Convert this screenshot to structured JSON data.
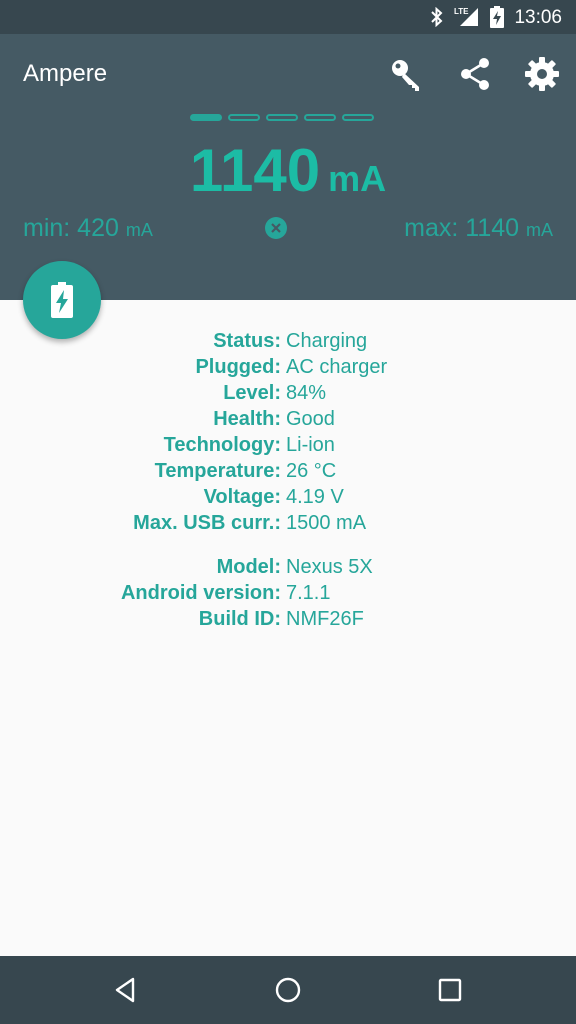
{
  "status_bar": {
    "time": "13:06",
    "network": "LTE",
    "icons": [
      "bluetooth-icon",
      "cellular-signal-icon",
      "battery-charging-icon"
    ]
  },
  "app_bar": {
    "title": "Ampere",
    "actions": [
      "key-icon",
      "share-icon",
      "settings-icon"
    ]
  },
  "page_indicator": {
    "total": 5,
    "active_index": 0
  },
  "reading": {
    "value": "1140",
    "unit": "mA"
  },
  "min": {
    "label": "min: 420",
    "unit": "mA"
  },
  "max": {
    "label": "max: 1140",
    "unit": "mA"
  },
  "battery_info": [
    {
      "label": "Status:",
      "value": "Charging"
    },
    {
      "label": "Plugged:",
      "value": "AC charger"
    },
    {
      "label": "Level:",
      "value": "84%"
    },
    {
      "label": "Health:",
      "value": "Good"
    },
    {
      "label": "Technology:",
      "value": "Li-ion"
    },
    {
      "label": "Temperature:",
      "value": "26 °C"
    },
    {
      "label": "Voltage:",
      "value": "4.19 V"
    },
    {
      "label": "Max. USB curr.:",
      "value": "1500 mA"
    }
  ],
  "device_info": [
    {
      "label": "Model:",
      "value": "Nexus 5X"
    },
    {
      "label": "Android version:",
      "value": "7.1.1"
    },
    {
      "label": "Build ID:",
      "value": "NMF26F"
    }
  ],
  "colors": {
    "accent": "#26a69a",
    "header": "#455a64",
    "status_bar": "#37474f",
    "background": "#fafafa"
  },
  "nav_bar": {
    "buttons": [
      "back-icon",
      "home-icon",
      "recents-icon"
    ]
  }
}
